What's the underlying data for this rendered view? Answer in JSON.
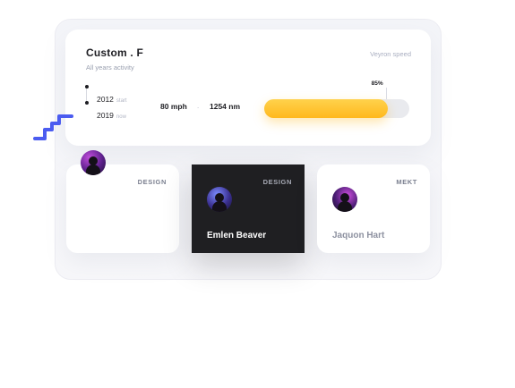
{
  "top_card": {
    "title": "Custom . F",
    "subtitle": "All years activity",
    "speed_link": "Veyron speed",
    "timeline": [
      {
        "year": "2012",
        "tag": "start"
      },
      {
        "year": "2019",
        "tag": "now"
      }
    ],
    "stats": {
      "speed": "80 mph",
      "separator": ".",
      "distance": "1254 nm"
    },
    "progress": {
      "percent": 85,
      "label": "85%",
      "color": "#ffb81d"
    }
  },
  "cards": [
    {
      "tag": "DESIGN",
      "name": ""
    },
    {
      "tag": "DESIGN",
      "name": "Emlen Beaver"
    },
    {
      "tag": "MEKT",
      "name": "Jaquon Hart"
    }
  ],
  "colors": {
    "accent_yellow": "#ffb81d",
    "squiggle_blue": "#4b5cf0",
    "dark_card": "#1f1f22"
  },
  "icons": {
    "squiggle": "squiggle-decoration",
    "avatar": "avatar-photo"
  }
}
